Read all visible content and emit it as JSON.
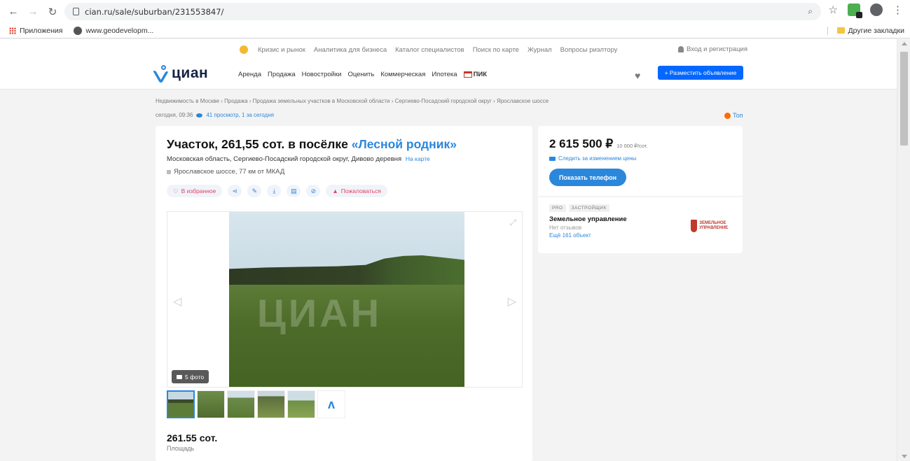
{
  "browser": {
    "url": "cian.ru/sale/suburban/231553847/",
    "bookmarks": [
      {
        "label": "Приложения"
      },
      {
        "label": "www.geodevelopm..."
      }
    ],
    "other_bookmarks": "Другие закладки"
  },
  "site": {
    "top_links": [
      "Кризис и рынок",
      "Аналитика для бизнеса",
      "Каталог специалистов",
      "Поиск по карте",
      "Журнал",
      "Вопросы риэлтору"
    ],
    "login": "Вход и регистрация",
    "logo_text": "циан",
    "nav": [
      "Аренда",
      "Продажа",
      "Новостройки",
      "Оценить",
      "Коммерческая",
      "Ипотека"
    ],
    "nav_pik": "ПИК",
    "post_button": "+ Разместить объявление"
  },
  "breadcrumbs": "Недвижимость в Москве  ›  Продажа  ›  Продажа земельных участков в Московской области  ›  Сергиево-Посадский городской округ  ›  Ярославское шоссе",
  "meta": {
    "updated": "сегодня, 09:36",
    "views": "41 просмотр, 1 за сегодня",
    "top": "Топ"
  },
  "listing": {
    "title_prefix": "Участок, 261,55 сот. в посёлке ",
    "title_highlight": "«Лесной родник»",
    "address": "Московская область, Сергиево-Посадский городской округ, Дивово деревня",
    "map_link": "На карте",
    "road": "Ярославское шоссе, 77 км от МКАД",
    "favorite": "В избранное",
    "complain": "Пожаловаться",
    "photo_count": "5 фото",
    "watermark": "ЦИАН",
    "area_value": "261.55 сот.",
    "area_label": "Площадь"
  },
  "price_card": {
    "price": "2 615 500 ₽",
    "price_per": "10 000 ₽/сот.",
    "follow": "Следить за изменением цены",
    "phone_button": "Показать телефон"
  },
  "seller": {
    "tags": [
      "PRO",
      "ЗАСТРОЙЩИК"
    ],
    "name": "Земельное управление",
    "reviews": "Нет отзывов",
    "more": "Ещё 161 объект",
    "logo_text": "ЗЕМЕЛЬНОЕ УПРАВЛЕНИЕ"
  }
}
